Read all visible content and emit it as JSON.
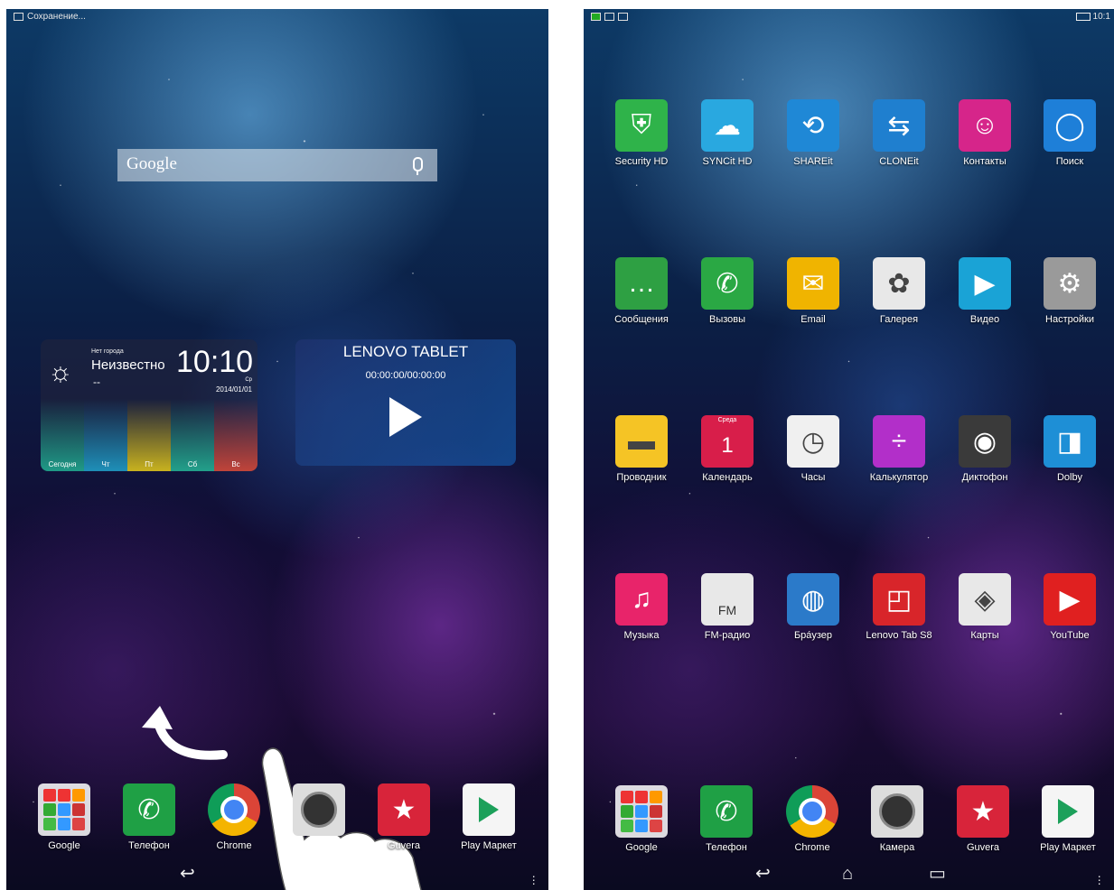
{
  "left_screen": {
    "status_text": "Сохранение...",
    "search": {
      "logo": "Google"
    },
    "weather_widget": {
      "city_label": "Нет города",
      "city": "Неизвестно",
      "temp": "--",
      "time": "10:10",
      "day_of_week": "Ср",
      "date": "2014/01/01",
      "days": [
        "Сегодня",
        "Чт",
        "Пт",
        "Сб",
        "Вс"
      ],
      "day_colors": [
        "#1f9a86",
        "#1e8fb8",
        "#c8b21f",
        "#22a08a",
        "#c0443a"
      ]
    },
    "music_widget": {
      "title": "LENOVO TABLET",
      "time": "00:00:00/00:00:00"
    },
    "dock": [
      {
        "label": "Google",
        "icon": "folder-icon"
      },
      {
        "label": "Телефон",
        "icon": "phone-icon"
      },
      {
        "label": "Chrome",
        "icon": "chrome-icon"
      },
      {
        "label": "",
        "icon": "camera-icon"
      },
      {
        "label": "Guvera",
        "icon": "star-icon"
      },
      {
        "label": "Play Маркет",
        "icon": "play-store-icon"
      }
    ]
  },
  "right_screen": {
    "status_time": "10:1",
    "apps": [
      {
        "label": "Security HD",
        "color": "#2fb34a"
      },
      {
        "label": "SYNCit HD",
        "color": "#29a8e0"
      },
      {
        "label": "SHAREit",
        "color": "#1f88d6"
      },
      {
        "label": "CLONEit",
        "color": "#1f7fcf"
      },
      {
        "label": "Контакты",
        "color": "#d6258a"
      },
      {
        "label": "Поиск",
        "color": "#1e7fd8"
      },
      {
        "label": "Сообщения",
        "color": "#2ea043"
      },
      {
        "label": "Вызовы",
        "color": "#2aa844"
      },
      {
        "label": "Email",
        "color": "#f0b400"
      },
      {
        "label": "Галерея",
        "color": "#e8e8e8"
      },
      {
        "label": "Видео",
        "color": "#1aa3d6"
      },
      {
        "label": "Настройки",
        "color": "#9a9a9a"
      },
      {
        "label": "Проводник",
        "color": "#f5c425"
      },
      {
        "label": "Календарь",
        "color": "#d81e4a"
      },
      {
        "label": "Часы",
        "color": "#f0f0f0"
      },
      {
        "label": "Калькулятор",
        "color": "#b22fc9"
      },
      {
        "label": "Диктофон",
        "color": "#3a3a3a"
      },
      {
        "label": "Dolby",
        "color": "#1e8fd6"
      },
      {
        "label": "Музыка",
        "color": "#e8246a"
      },
      {
        "label": "FM-радио",
        "color": "#e8e8e8"
      },
      {
        "label": "Брáузер",
        "color": "#2b7ac9"
      },
      {
        "label": "Lenovo Tab S8",
        "color": "#d8252a"
      },
      {
        "label": "Карты",
        "color": "#e8e8e8"
      },
      {
        "label": "YouTube",
        "color": "#e02020"
      }
    ],
    "calendar_day_label": "Среда",
    "calendar_day": "1",
    "fm_label": "FM",
    "dock": [
      {
        "label": "Google",
        "icon": "folder-icon"
      },
      {
        "label": "Телефон",
        "icon": "phone-icon"
      },
      {
        "label": "Chrome",
        "icon": "chrome-icon"
      },
      {
        "label": "Камера",
        "icon": "camera-icon"
      },
      {
        "label": "Guvera",
        "icon": "star-icon"
      },
      {
        "label": "Play Маркет",
        "icon": "play-store-icon"
      }
    ]
  }
}
